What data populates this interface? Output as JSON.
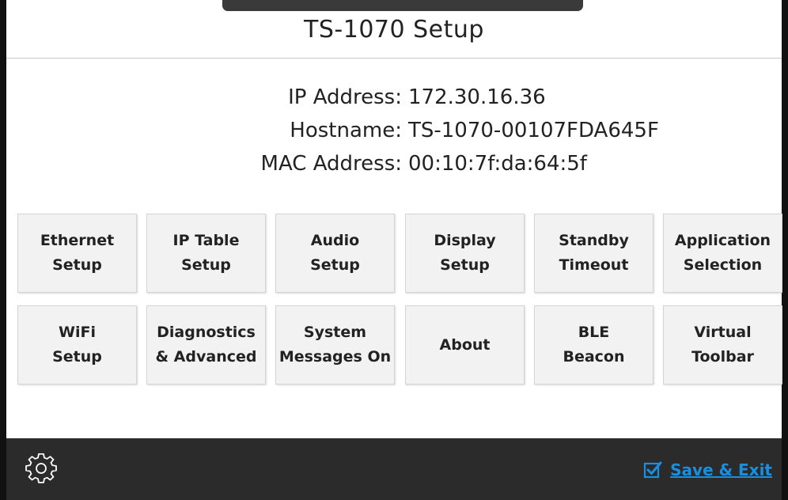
{
  "header": {
    "title": "TS-1070 Setup"
  },
  "info": [
    {
      "label": "IP Address:",
      "value": "172.30.16.36"
    },
    {
      "label": "Hostname:",
      "value": "TS-1070-00107FDA645F"
    },
    {
      "label": "MAC Address:",
      "value": "00:10:7f:da:64:5f"
    }
  ],
  "buttons": [
    {
      "label": "Ethernet\nSetup"
    },
    {
      "label": "IP Table\nSetup"
    },
    {
      "label": "Audio\nSetup"
    },
    {
      "label": "Display\nSetup"
    },
    {
      "label": "Standby\nTimeout"
    },
    {
      "label": "Application\nSelection"
    },
    {
      "label": "WiFi\nSetup"
    },
    {
      "label": "Diagnostics\n& Advanced"
    },
    {
      "label": "System\nMessages On"
    },
    {
      "label": "About"
    },
    {
      "label": "BLE\nBeacon"
    },
    {
      "label": "Virtual\nToolbar"
    }
  ],
  "footer": {
    "settings_icon": "gear-icon",
    "save_label": "Save & Exit",
    "save_icon": "checkbox-checked-icon",
    "accent_color": "#1a8fe0"
  }
}
